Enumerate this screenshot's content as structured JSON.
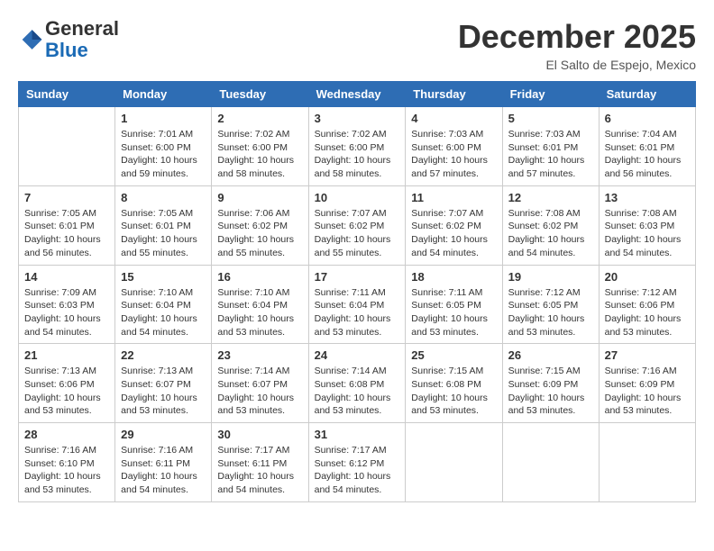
{
  "header": {
    "logo_line1": "General",
    "logo_line2": "Blue",
    "month_title": "December 2025",
    "location": "El Salto de Espejo, Mexico"
  },
  "days_of_week": [
    "Sunday",
    "Monday",
    "Tuesday",
    "Wednesday",
    "Thursday",
    "Friday",
    "Saturday"
  ],
  "weeks": [
    [
      {
        "day": "",
        "info": ""
      },
      {
        "day": "1",
        "info": "Sunrise: 7:01 AM\nSunset: 6:00 PM\nDaylight: 10 hours\nand 59 minutes."
      },
      {
        "day": "2",
        "info": "Sunrise: 7:02 AM\nSunset: 6:00 PM\nDaylight: 10 hours\nand 58 minutes."
      },
      {
        "day": "3",
        "info": "Sunrise: 7:02 AM\nSunset: 6:00 PM\nDaylight: 10 hours\nand 58 minutes."
      },
      {
        "day": "4",
        "info": "Sunrise: 7:03 AM\nSunset: 6:00 PM\nDaylight: 10 hours\nand 57 minutes."
      },
      {
        "day": "5",
        "info": "Sunrise: 7:03 AM\nSunset: 6:01 PM\nDaylight: 10 hours\nand 57 minutes."
      },
      {
        "day": "6",
        "info": "Sunrise: 7:04 AM\nSunset: 6:01 PM\nDaylight: 10 hours\nand 56 minutes."
      }
    ],
    [
      {
        "day": "7",
        "info": "Sunrise: 7:05 AM\nSunset: 6:01 PM\nDaylight: 10 hours\nand 56 minutes."
      },
      {
        "day": "8",
        "info": "Sunrise: 7:05 AM\nSunset: 6:01 PM\nDaylight: 10 hours\nand 55 minutes."
      },
      {
        "day": "9",
        "info": "Sunrise: 7:06 AM\nSunset: 6:02 PM\nDaylight: 10 hours\nand 55 minutes."
      },
      {
        "day": "10",
        "info": "Sunrise: 7:07 AM\nSunset: 6:02 PM\nDaylight: 10 hours\nand 55 minutes."
      },
      {
        "day": "11",
        "info": "Sunrise: 7:07 AM\nSunset: 6:02 PM\nDaylight: 10 hours\nand 54 minutes."
      },
      {
        "day": "12",
        "info": "Sunrise: 7:08 AM\nSunset: 6:02 PM\nDaylight: 10 hours\nand 54 minutes."
      },
      {
        "day": "13",
        "info": "Sunrise: 7:08 AM\nSunset: 6:03 PM\nDaylight: 10 hours\nand 54 minutes."
      }
    ],
    [
      {
        "day": "14",
        "info": "Sunrise: 7:09 AM\nSunset: 6:03 PM\nDaylight: 10 hours\nand 54 minutes."
      },
      {
        "day": "15",
        "info": "Sunrise: 7:10 AM\nSunset: 6:04 PM\nDaylight: 10 hours\nand 54 minutes."
      },
      {
        "day": "16",
        "info": "Sunrise: 7:10 AM\nSunset: 6:04 PM\nDaylight: 10 hours\nand 53 minutes."
      },
      {
        "day": "17",
        "info": "Sunrise: 7:11 AM\nSunset: 6:04 PM\nDaylight: 10 hours\nand 53 minutes."
      },
      {
        "day": "18",
        "info": "Sunrise: 7:11 AM\nSunset: 6:05 PM\nDaylight: 10 hours\nand 53 minutes."
      },
      {
        "day": "19",
        "info": "Sunrise: 7:12 AM\nSunset: 6:05 PM\nDaylight: 10 hours\nand 53 minutes."
      },
      {
        "day": "20",
        "info": "Sunrise: 7:12 AM\nSunset: 6:06 PM\nDaylight: 10 hours\nand 53 minutes."
      }
    ],
    [
      {
        "day": "21",
        "info": "Sunrise: 7:13 AM\nSunset: 6:06 PM\nDaylight: 10 hours\nand 53 minutes."
      },
      {
        "day": "22",
        "info": "Sunrise: 7:13 AM\nSunset: 6:07 PM\nDaylight: 10 hours\nand 53 minutes."
      },
      {
        "day": "23",
        "info": "Sunrise: 7:14 AM\nSunset: 6:07 PM\nDaylight: 10 hours\nand 53 minutes."
      },
      {
        "day": "24",
        "info": "Sunrise: 7:14 AM\nSunset: 6:08 PM\nDaylight: 10 hours\nand 53 minutes."
      },
      {
        "day": "25",
        "info": "Sunrise: 7:15 AM\nSunset: 6:08 PM\nDaylight: 10 hours\nand 53 minutes."
      },
      {
        "day": "26",
        "info": "Sunrise: 7:15 AM\nSunset: 6:09 PM\nDaylight: 10 hours\nand 53 minutes."
      },
      {
        "day": "27",
        "info": "Sunrise: 7:16 AM\nSunset: 6:09 PM\nDaylight: 10 hours\nand 53 minutes."
      }
    ],
    [
      {
        "day": "28",
        "info": "Sunrise: 7:16 AM\nSunset: 6:10 PM\nDaylight: 10 hours\nand 53 minutes."
      },
      {
        "day": "29",
        "info": "Sunrise: 7:16 AM\nSunset: 6:11 PM\nDaylight: 10 hours\nand 54 minutes."
      },
      {
        "day": "30",
        "info": "Sunrise: 7:17 AM\nSunset: 6:11 PM\nDaylight: 10 hours\nand 54 minutes."
      },
      {
        "day": "31",
        "info": "Sunrise: 7:17 AM\nSunset: 6:12 PM\nDaylight: 10 hours\nand 54 minutes."
      },
      {
        "day": "",
        "info": ""
      },
      {
        "day": "",
        "info": ""
      },
      {
        "day": "",
        "info": ""
      }
    ]
  ]
}
